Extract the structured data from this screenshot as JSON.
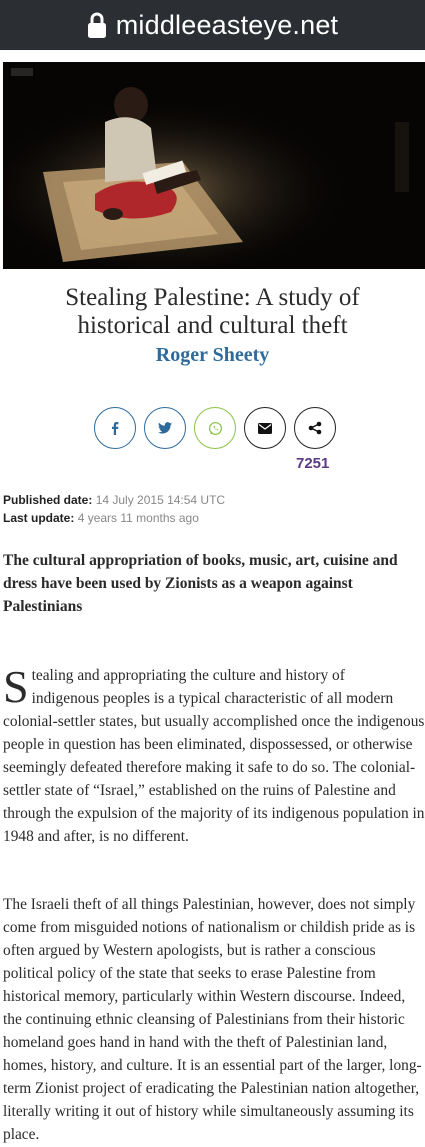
{
  "browser": {
    "url": "middleeasteye.net"
  },
  "article": {
    "title": "Stealing Palestine: A study of historical and cultural theft",
    "author": "Roger Sheety",
    "share_count": "7251",
    "published_label": "Published date:",
    "published_value": "14 July 2015 14:54 UTC",
    "updated_label": "Last update:",
    "updated_value": "4 years 11 months ago",
    "standfirst": "The cultural appropriation of books, music, art, cuisine and dress have been used by Zionists as a weapon against Palestinians",
    "dropcap": "S",
    "p1_first": "tealing and appropriating the culture and history of",
    "p1_second": "indigenous peoples is a typical characteristic of all modern",
    "p1_rest": "colonial-settler states, but usually accomplished once the indigenous people in question has been eliminated, dispossessed, or otherwise seemingly defeated therefore making it safe to do so.  The colonial-settler state of “Israel,” established on the ruins of Palestine and through the expulsion of the majority of its indigenous population in 1948 and after, is no different.",
    "p2": "The Israeli theft of all things Palestinian, however, does not simply come from misguided notions of nationalism or childish pride as is often argued by Western apologists, but is rather a conscious political policy of the state that seeks to erase Palestine from historical memory, particularly within Western discourse. Indeed, the continuing ethnic cleansing of Palestinians from their historic homeland goes hand in hand with the theft of Palestinian land, homes, history, and culture.  It is an essential part of the larger, long-term Zionist project of eradicating the Palestinian nation altogether, literally writing it out of history while simultaneously assuming its place."
  },
  "share_buttons": [
    {
      "icon": "facebook-icon"
    },
    {
      "icon": "twitter-icon"
    },
    {
      "icon": "whatsapp-icon"
    },
    {
      "icon": "email-icon"
    },
    {
      "icon": "share-icon"
    }
  ],
  "colors": {
    "accent_blue": "#2f6a9b",
    "whatsapp_green": "#8bc34a",
    "count_purple": "#5b3b86",
    "urlbar_bg": "#2b2f33"
  }
}
